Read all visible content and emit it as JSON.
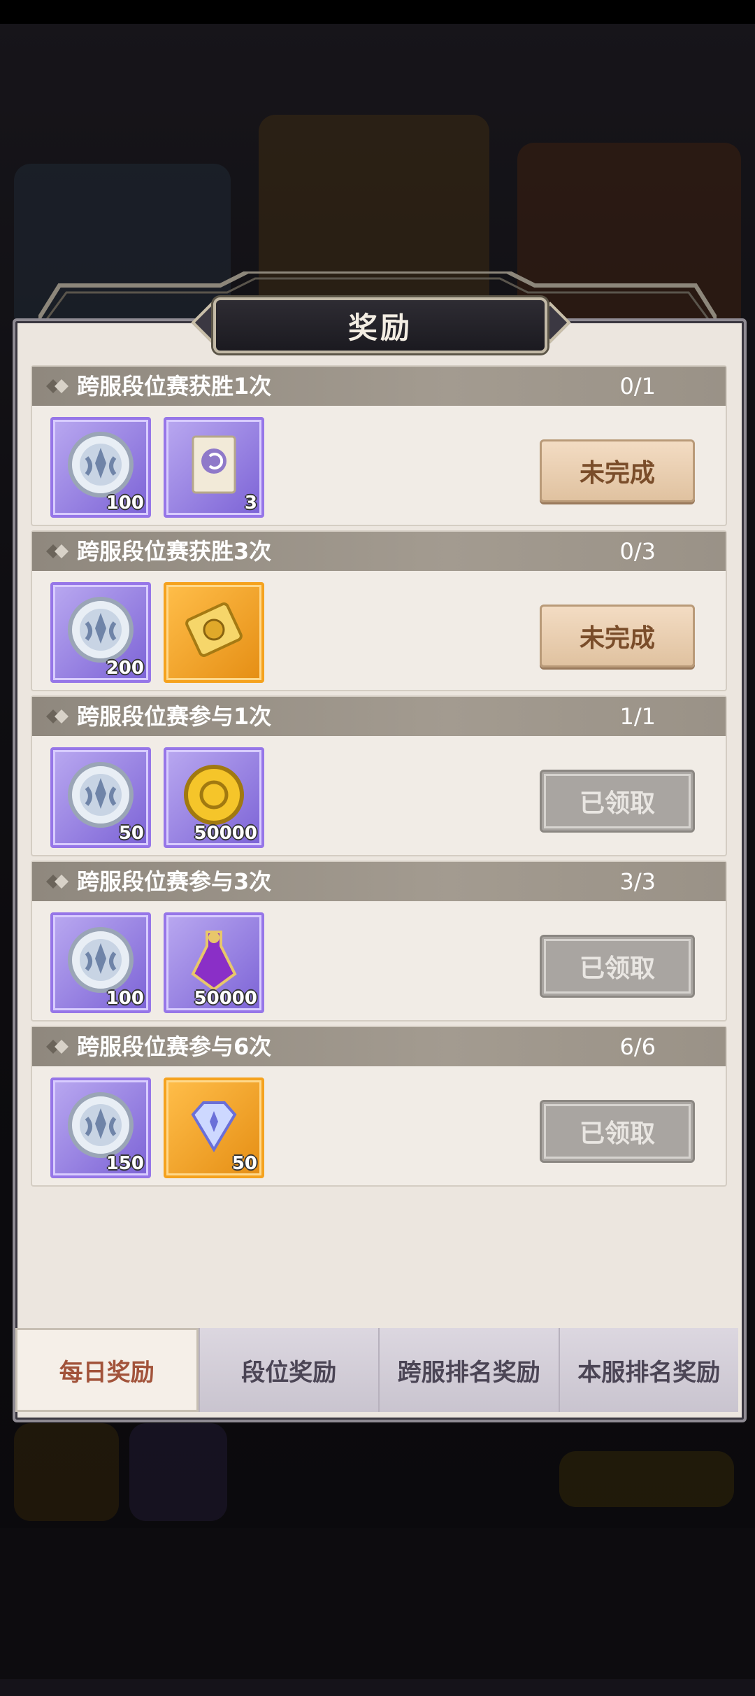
{
  "dialog": {
    "title": "奖励"
  },
  "tasks": [
    {
      "title": "跨服段位赛获胜1次",
      "progress": "0/1",
      "items": [
        {
          "icon": "silver-medal-icon",
          "qty": "100",
          "frame": "purple"
        },
        {
          "icon": "scroll-ticket-icon",
          "qty": "3",
          "frame": "purple"
        }
      ],
      "button": "未完成",
      "state": "incomplete"
    },
    {
      "title": "跨服段位赛获胜3次",
      "progress": "0/3",
      "items": [
        {
          "icon": "silver-medal-icon",
          "qty": "200",
          "frame": "purple"
        },
        {
          "icon": "gold-ticket-icon",
          "qty": "",
          "frame": "orange"
        }
      ],
      "button": "未完成",
      "state": "incomplete"
    },
    {
      "title": "跨服段位赛参与1次",
      "progress": "1/1",
      "items": [
        {
          "icon": "silver-medal-icon",
          "qty": "50",
          "frame": "purple"
        },
        {
          "icon": "gold-coin-icon",
          "qty": "50000",
          "frame": "purple"
        }
      ],
      "button": "已领取",
      "state": "claimed"
    },
    {
      "title": "跨服段位赛参与3次",
      "progress": "3/3",
      "items": [
        {
          "icon": "silver-medal-icon",
          "qty": "100",
          "frame": "purple"
        },
        {
          "icon": "purple-potion-icon",
          "qty": "50000",
          "frame": "purple"
        }
      ],
      "button": "已领取",
      "state": "claimed"
    },
    {
      "title": "跨服段位赛参与6次",
      "progress": "6/6",
      "items": [
        {
          "icon": "silver-medal-icon",
          "qty": "150",
          "frame": "purple"
        },
        {
          "icon": "diamond-icon",
          "qty": "50",
          "frame": "orange"
        }
      ],
      "button": "已领取",
      "state": "claimed"
    }
  ],
  "tabs": [
    {
      "label": "每日奖励",
      "active": true
    },
    {
      "label": "段位奖励",
      "active": false
    },
    {
      "label": "跨服排名奖励",
      "active": false
    },
    {
      "label": "本服排名奖励",
      "active": false
    }
  ]
}
